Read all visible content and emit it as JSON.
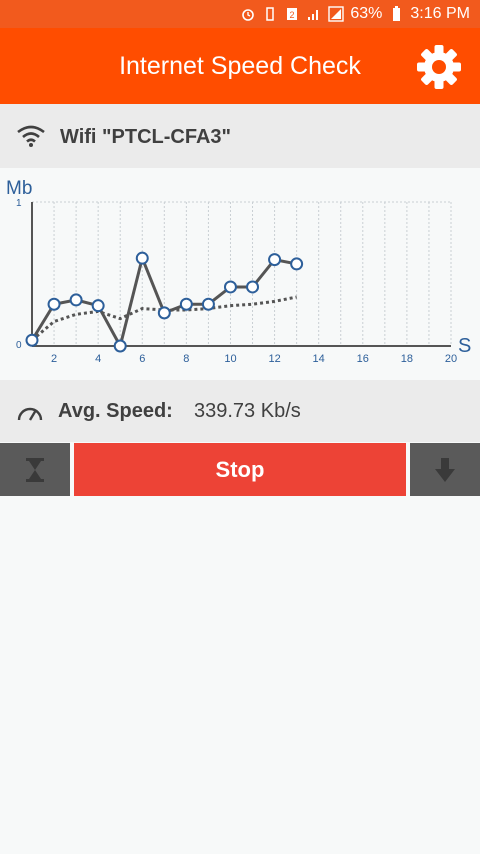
{
  "status_bar": {
    "battery": "63%",
    "time": "3:16 PM"
  },
  "app_bar": {
    "title": "Internet Speed Check",
    "color": "#ff4d00"
  },
  "network": {
    "label": "Wifi \"PTCL-CFA3\"",
    "icon": "wifi-icon"
  },
  "chart_data": {
    "type": "line",
    "ylabel": "Mb",
    "xlabel": "S",
    "ylim": [
      0,
      1
    ],
    "xlim": [
      1,
      20
    ],
    "yticks": [
      "1",
      "0"
    ],
    "xticks": [
      2,
      4,
      6,
      8,
      10,
      12,
      14,
      16,
      18,
      20
    ],
    "grid": true,
    "series": [
      {
        "x": [
          1,
          2,
          3,
          4,
          5,
          6,
          7,
          8,
          9,
          10,
          11,
          12,
          13
        ],
        "values": [
          0.04,
          0.29,
          0.32,
          0.28,
          0.0,
          0.61,
          0.23,
          0.29,
          0.29,
          0.41,
          0.41,
          0.6,
          0.57
        ],
        "color": "#555555"
      },
      {
        "x": [
          1,
          2,
          3,
          4,
          5,
          6,
          7,
          8,
          9,
          10,
          11,
          12,
          13
        ],
        "values": [
          0.04,
          0.17,
          0.22,
          0.24,
          0.19,
          0.26,
          0.25,
          0.25,
          0.26,
          0.28,
          0.29,
          0.31,
          0.34
        ],
        "color": "#555555",
        "style": "dotted"
      }
    ]
  },
  "avg": {
    "label": "Avg. Speed:",
    "value": "339.73 Kb/s"
  },
  "controls": {
    "timer_icon": "hourglass-icon",
    "stop_label": "Stop",
    "download_icon": "arrow-down-icon"
  }
}
